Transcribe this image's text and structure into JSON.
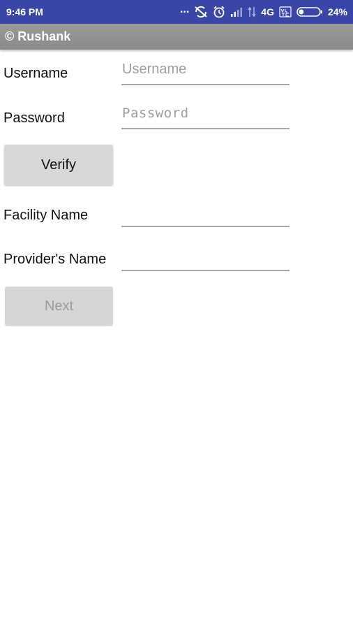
{
  "status_bar": {
    "time": "9:46 PM",
    "dots": "...",
    "network": "4G",
    "battery": "24%",
    "icons": [
      "overflow-dots-icon",
      "sync-disabled-icon",
      "alarm-icon",
      "signal-icon",
      "data-arrows-icon",
      "volte-icon",
      "battery-icon"
    ],
    "battery_level": 0.24
  },
  "toolbar": {
    "title": "© Rushank"
  },
  "form": {
    "username_label": "Username",
    "username_placeholder": "Username",
    "password_label": "Password",
    "password_placeholder": "Password",
    "verify_label": "Verify",
    "facility_label": "Facility Name",
    "facility_value": "",
    "provider_label": "Provider's Name",
    "provider_value": "",
    "next_label": "Next"
  },
  "colors": {
    "status_bar": "#3a45a8",
    "toolbar": "#909090",
    "button": "#d8d8d8",
    "underline": "#a8a8a8"
  }
}
